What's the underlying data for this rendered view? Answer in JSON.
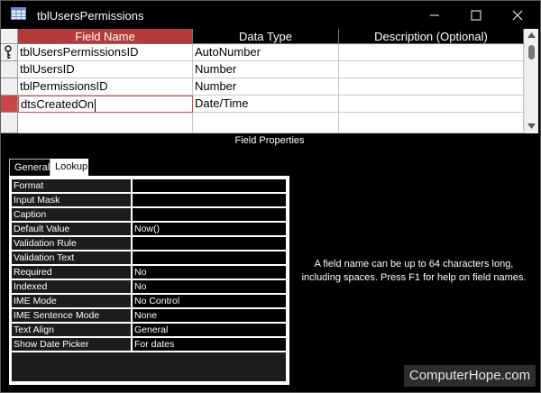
{
  "window": {
    "title": "tblUsersPermissions",
    "icon": "table-icon"
  },
  "grid": {
    "columns": [
      "Field Name",
      "Data Type",
      "Description (Optional)"
    ],
    "rows": [
      {
        "field": "tblUsersPermissionsID",
        "type": "AutoNumber",
        "description": ""
      },
      {
        "field": "tblUsersID",
        "type": "Number",
        "description": ""
      },
      {
        "field": "tblPermissionsID",
        "type": "Number",
        "description": ""
      },
      {
        "field": "dtsCreatedOn",
        "type": "Date/Time",
        "description": ""
      }
    ]
  },
  "field_properties": {
    "label": "Field Properties",
    "tabs": [
      "General",
      "Lookup"
    ],
    "properties": [
      {
        "name": "Format",
        "value": ""
      },
      {
        "name": "Input Mask",
        "value": ""
      },
      {
        "name": "Caption",
        "value": ""
      },
      {
        "name": "Default Value",
        "value": "Now()"
      },
      {
        "name": "Validation Rule",
        "value": ""
      },
      {
        "name": "Validation Text",
        "value": ""
      },
      {
        "name": "Required",
        "value": "No"
      },
      {
        "name": "Indexed",
        "value": "No"
      },
      {
        "name": "IME Mode",
        "value": "No Control"
      },
      {
        "name": "IME Sentence Mode",
        "value": "None"
      },
      {
        "name": "Text Align",
        "value": "General"
      },
      {
        "name": "Show Date Picker",
        "value": "For dates"
      }
    ],
    "help_text": "A field name can be up to 64 characters long, including spaces. Press F1 for help on field names."
  },
  "watermark": "ComputerHope.com",
  "colors": {
    "accent": "#b43a3a",
    "background": "#000000"
  }
}
